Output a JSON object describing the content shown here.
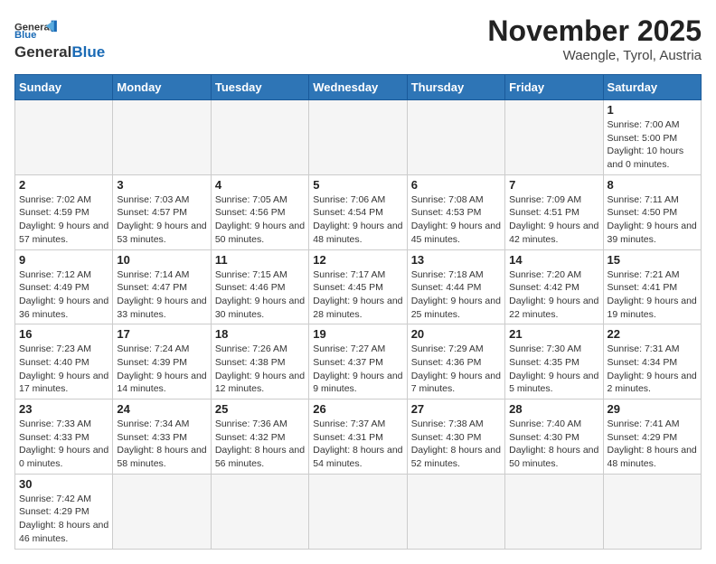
{
  "logo": {
    "general": "General",
    "blue": "Blue"
  },
  "header": {
    "month": "November 2025",
    "location": "Waengle, Tyrol, Austria"
  },
  "weekdays": [
    "Sunday",
    "Monday",
    "Tuesday",
    "Wednesday",
    "Thursday",
    "Friday",
    "Saturday"
  ],
  "weeks": [
    [
      {
        "day": "",
        "info": ""
      },
      {
        "day": "",
        "info": ""
      },
      {
        "day": "",
        "info": ""
      },
      {
        "day": "",
        "info": ""
      },
      {
        "day": "",
        "info": ""
      },
      {
        "day": "",
        "info": ""
      },
      {
        "day": "1",
        "info": "Sunrise: 7:00 AM\nSunset: 5:00 PM\nDaylight: 10 hours and 0 minutes."
      }
    ],
    [
      {
        "day": "2",
        "info": "Sunrise: 7:02 AM\nSunset: 4:59 PM\nDaylight: 9 hours and 57 minutes."
      },
      {
        "day": "3",
        "info": "Sunrise: 7:03 AM\nSunset: 4:57 PM\nDaylight: 9 hours and 53 minutes."
      },
      {
        "day": "4",
        "info": "Sunrise: 7:05 AM\nSunset: 4:56 PM\nDaylight: 9 hours and 50 minutes."
      },
      {
        "day": "5",
        "info": "Sunrise: 7:06 AM\nSunset: 4:54 PM\nDaylight: 9 hours and 48 minutes."
      },
      {
        "day": "6",
        "info": "Sunrise: 7:08 AM\nSunset: 4:53 PM\nDaylight: 9 hours and 45 minutes."
      },
      {
        "day": "7",
        "info": "Sunrise: 7:09 AM\nSunset: 4:51 PM\nDaylight: 9 hours and 42 minutes."
      },
      {
        "day": "8",
        "info": "Sunrise: 7:11 AM\nSunset: 4:50 PM\nDaylight: 9 hours and 39 minutes."
      }
    ],
    [
      {
        "day": "9",
        "info": "Sunrise: 7:12 AM\nSunset: 4:49 PM\nDaylight: 9 hours and 36 minutes."
      },
      {
        "day": "10",
        "info": "Sunrise: 7:14 AM\nSunset: 4:47 PM\nDaylight: 9 hours and 33 minutes."
      },
      {
        "day": "11",
        "info": "Sunrise: 7:15 AM\nSunset: 4:46 PM\nDaylight: 9 hours and 30 minutes."
      },
      {
        "day": "12",
        "info": "Sunrise: 7:17 AM\nSunset: 4:45 PM\nDaylight: 9 hours and 28 minutes."
      },
      {
        "day": "13",
        "info": "Sunrise: 7:18 AM\nSunset: 4:44 PM\nDaylight: 9 hours and 25 minutes."
      },
      {
        "day": "14",
        "info": "Sunrise: 7:20 AM\nSunset: 4:42 PM\nDaylight: 9 hours and 22 minutes."
      },
      {
        "day": "15",
        "info": "Sunrise: 7:21 AM\nSunset: 4:41 PM\nDaylight: 9 hours and 19 minutes."
      }
    ],
    [
      {
        "day": "16",
        "info": "Sunrise: 7:23 AM\nSunset: 4:40 PM\nDaylight: 9 hours and 17 minutes."
      },
      {
        "day": "17",
        "info": "Sunrise: 7:24 AM\nSunset: 4:39 PM\nDaylight: 9 hours and 14 minutes."
      },
      {
        "day": "18",
        "info": "Sunrise: 7:26 AM\nSunset: 4:38 PM\nDaylight: 9 hours and 12 minutes."
      },
      {
        "day": "19",
        "info": "Sunrise: 7:27 AM\nSunset: 4:37 PM\nDaylight: 9 hours and 9 minutes."
      },
      {
        "day": "20",
        "info": "Sunrise: 7:29 AM\nSunset: 4:36 PM\nDaylight: 9 hours and 7 minutes."
      },
      {
        "day": "21",
        "info": "Sunrise: 7:30 AM\nSunset: 4:35 PM\nDaylight: 9 hours and 5 minutes."
      },
      {
        "day": "22",
        "info": "Sunrise: 7:31 AM\nSunset: 4:34 PM\nDaylight: 9 hours and 2 minutes."
      }
    ],
    [
      {
        "day": "23",
        "info": "Sunrise: 7:33 AM\nSunset: 4:33 PM\nDaylight: 9 hours and 0 minutes."
      },
      {
        "day": "24",
        "info": "Sunrise: 7:34 AM\nSunset: 4:33 PM\nDaylight: 8 hours and 58 minutes."
      },
      {
        "day": "25",
        "info": "Sunrise: 7:36 AM\nSunset: 4:32 PM\nDaylight: 8 hours and 56 minutes."
      },
      {
        "day": "26",
        "info": "Sunrise: 7:37 AM\nSunset: 4:31 PM\nDaylight: 8 hours and 54 minutes."
      },
      {
        "day": "27",
        "info": "Sunrise: 7:38 AM\nSunset: 4:30 PM\nDaylight: 8 hours and 52 minutes."
      },
      {
        "day": "28",
        "info": "Sunrise: 7:40 AM\nSunset: 4:30 PM\nDaylight: 8 hours and 50 minutes."
      },
      {
        "day": "29",
        "info": "Sunrise: 7:41 AM\nSunset: 4:29 PM\nDaylight: 8 hours and 48 minutes."
      }
    ],
    [
      {
        "day": "30",
        "info": "Sunrise: 7:42 AM\nSunset: 4:29 PM\nDaylight: 8 hours and 46 minutes."
      },
      {
        "day": "",
        "info": ""
      },
      {
        "day": "",
        "info": ""
      },
      {
        "day": "",
        "info": ""
      },
      {
        "day": "",
        "info": ""
      },
      {
        "day": "",
        "info": ""
      },
      {
        "day": "",
        "info": ""
      }
    ]
  ]
}
